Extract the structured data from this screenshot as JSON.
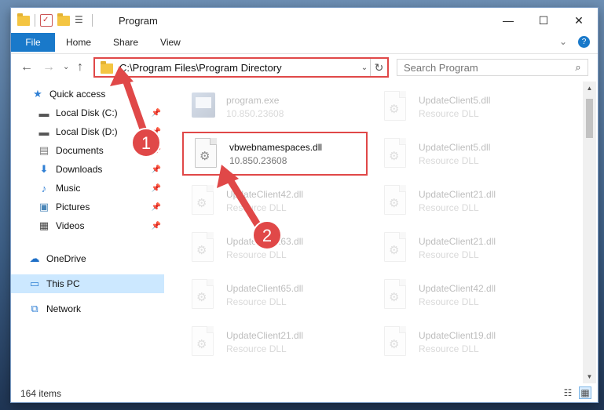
{
  "window": {
    "title": "Program"
  },
  "ribbon": {
    "tabs": [
      "File",
      "Home",
      "Share",
      "View"
    ]
  },
  "address": {
    "path": "C:\\Program Files\\Program Directory"
  },
  "search": {
    "placeholder": "Search Program"
  },
  "sidebar": {
    "items": [
      {
        "label": "Quick access",
        "icon": "star-icon",
        "pinned": false
      },
      {
        "label": "Local Disk (C:)",
        "icon": "drive-icon",
        "pinned": true
      },
      {
        "label": "Local Disk (D:)",
        "icon": "drive-icon",
        "pinned": true
      },
      {
        "label": "Documents",
        "icon": "documents-icon",
        "pinned": true
      },
      {
        "label": "Downloads",
        "icon": "download-icon",
        "pinned": true
      },
      {
        "label": "Music",
        "icon": "music-icon",
        "pinned": true
      },
      {
        "label": "Pictures",
        "icon": "pictures-icon",
        "pinned": true
      },
      {
        "label": "Videos",
        "icon": "videos-icon",
        "pinned": true
      },
      {
        "label": "OneDrive",
        "icon": "cloud-icon",
        "pinned": false
      },
      {
        "label": "This PC",
        "icon": "computer-icon",
        "pinned": false,
        "selected": true
      },
      {
        "label": "Network",
        "icon": "network-icon",
        "pinned": false
      }
    ]
  },
  "files": [
    {
      "name": "program.exe",
      "desc": "10.850.23608",
      "type": "exe"
    },
    {
      "name": "UpdateClient5.dll",
      "desc": "Resource DLL",
      "type": "dll"
    },
    {
      "name": "vbwebnamespaces.dll",
      "desc": "10.850.23608",
      "type": "dll",
      "highlighted": true
    },
    {
      "name": "UpdateClient5.dll",
      "desc": "Resource DLL",
      "type": "dll"
    },
    {
      "name": "UpdateClient42.dll",
      "desc": "Resource DLL",
      "type": "dll"
    },
    {
      "name": "UpdateClient21.dll",
      "desc": "Resource DLL",
      "type": "dll"
    },
    {
      "name": "UpdateClient63.dll",
      "desc": "Resource DLL",
      "type": "dll"
    },
    {
      "name": "UpdateClient21.dll",
      "desc": "Resource DLL",
      "type": "dll"
    },
    {
      "name": "UpdateClient65.dll",
      "desc": "Resource DLL",
      "type": "dll"
    },
    {
      "name": "UpdateClient42.dll",
      "desc": "Resource DLL",
      "type": "dll"
    },
    {
      "name": "UpdateClient21.dll",
      "desc": "Resource DLL",
      "type": "dll"
    },
    {
      "name": "UpdateClient19.dll",
      "desc": "Resource DLL",
      "type": "dll"
    }
  ],
  "status": {
    "item_count": "164 items"
  },
  "annotations": {
    "step1": "1",
    "step2": "2",
    "color": "#e04848"
  }
}
